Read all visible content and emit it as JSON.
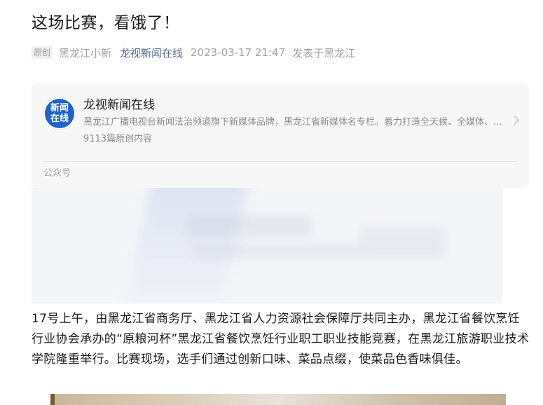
{
  "article": {
    "title": "这场比赛，看饿了！",
    "badge": "原创",
    "author": "黑龙江小新",
    "account": "龙视新闻在线",
    "datetime": "2023-03-17 21:47",
    "location": "发表于黑龙江",
    "body": "17号上午，由黑龙江省商务厅、黑龙江省人力资源社会保障厅共同主办，黑龙江省餐饮烹饪行业协会承办的“原粮河杯”黑龙江省餐饮烹饪行业职工职业技能竞赛，在黑龙江旅游职业技术学院隆重举行。比赛现场，选手们通过创新口味、菜品点缀，使菜品色香味俱佳。"
  },
  "profile_card": {
    "avatar_line1": "新闻",
    "avatar_line2": "在线",
    "name": "龙视新闻在线",
    "description": "黑龙江广播电视台新闻法治频道旗下新媒体品牌，黑龙江省新媒体名专栏。着力打造全天候、全媒体、全覆盖的新闻资讯平台。",
    "article_count": "9113篇原创内容",
    "footer": "公众号",
    "chevron_icon": "chevron-right-icon"
  },
  "colors": {
    "account_link": "#576b95",
    "avatar_bg": "#1e63c8",
    "card_bg": "#f7f7f7"
  }
}
